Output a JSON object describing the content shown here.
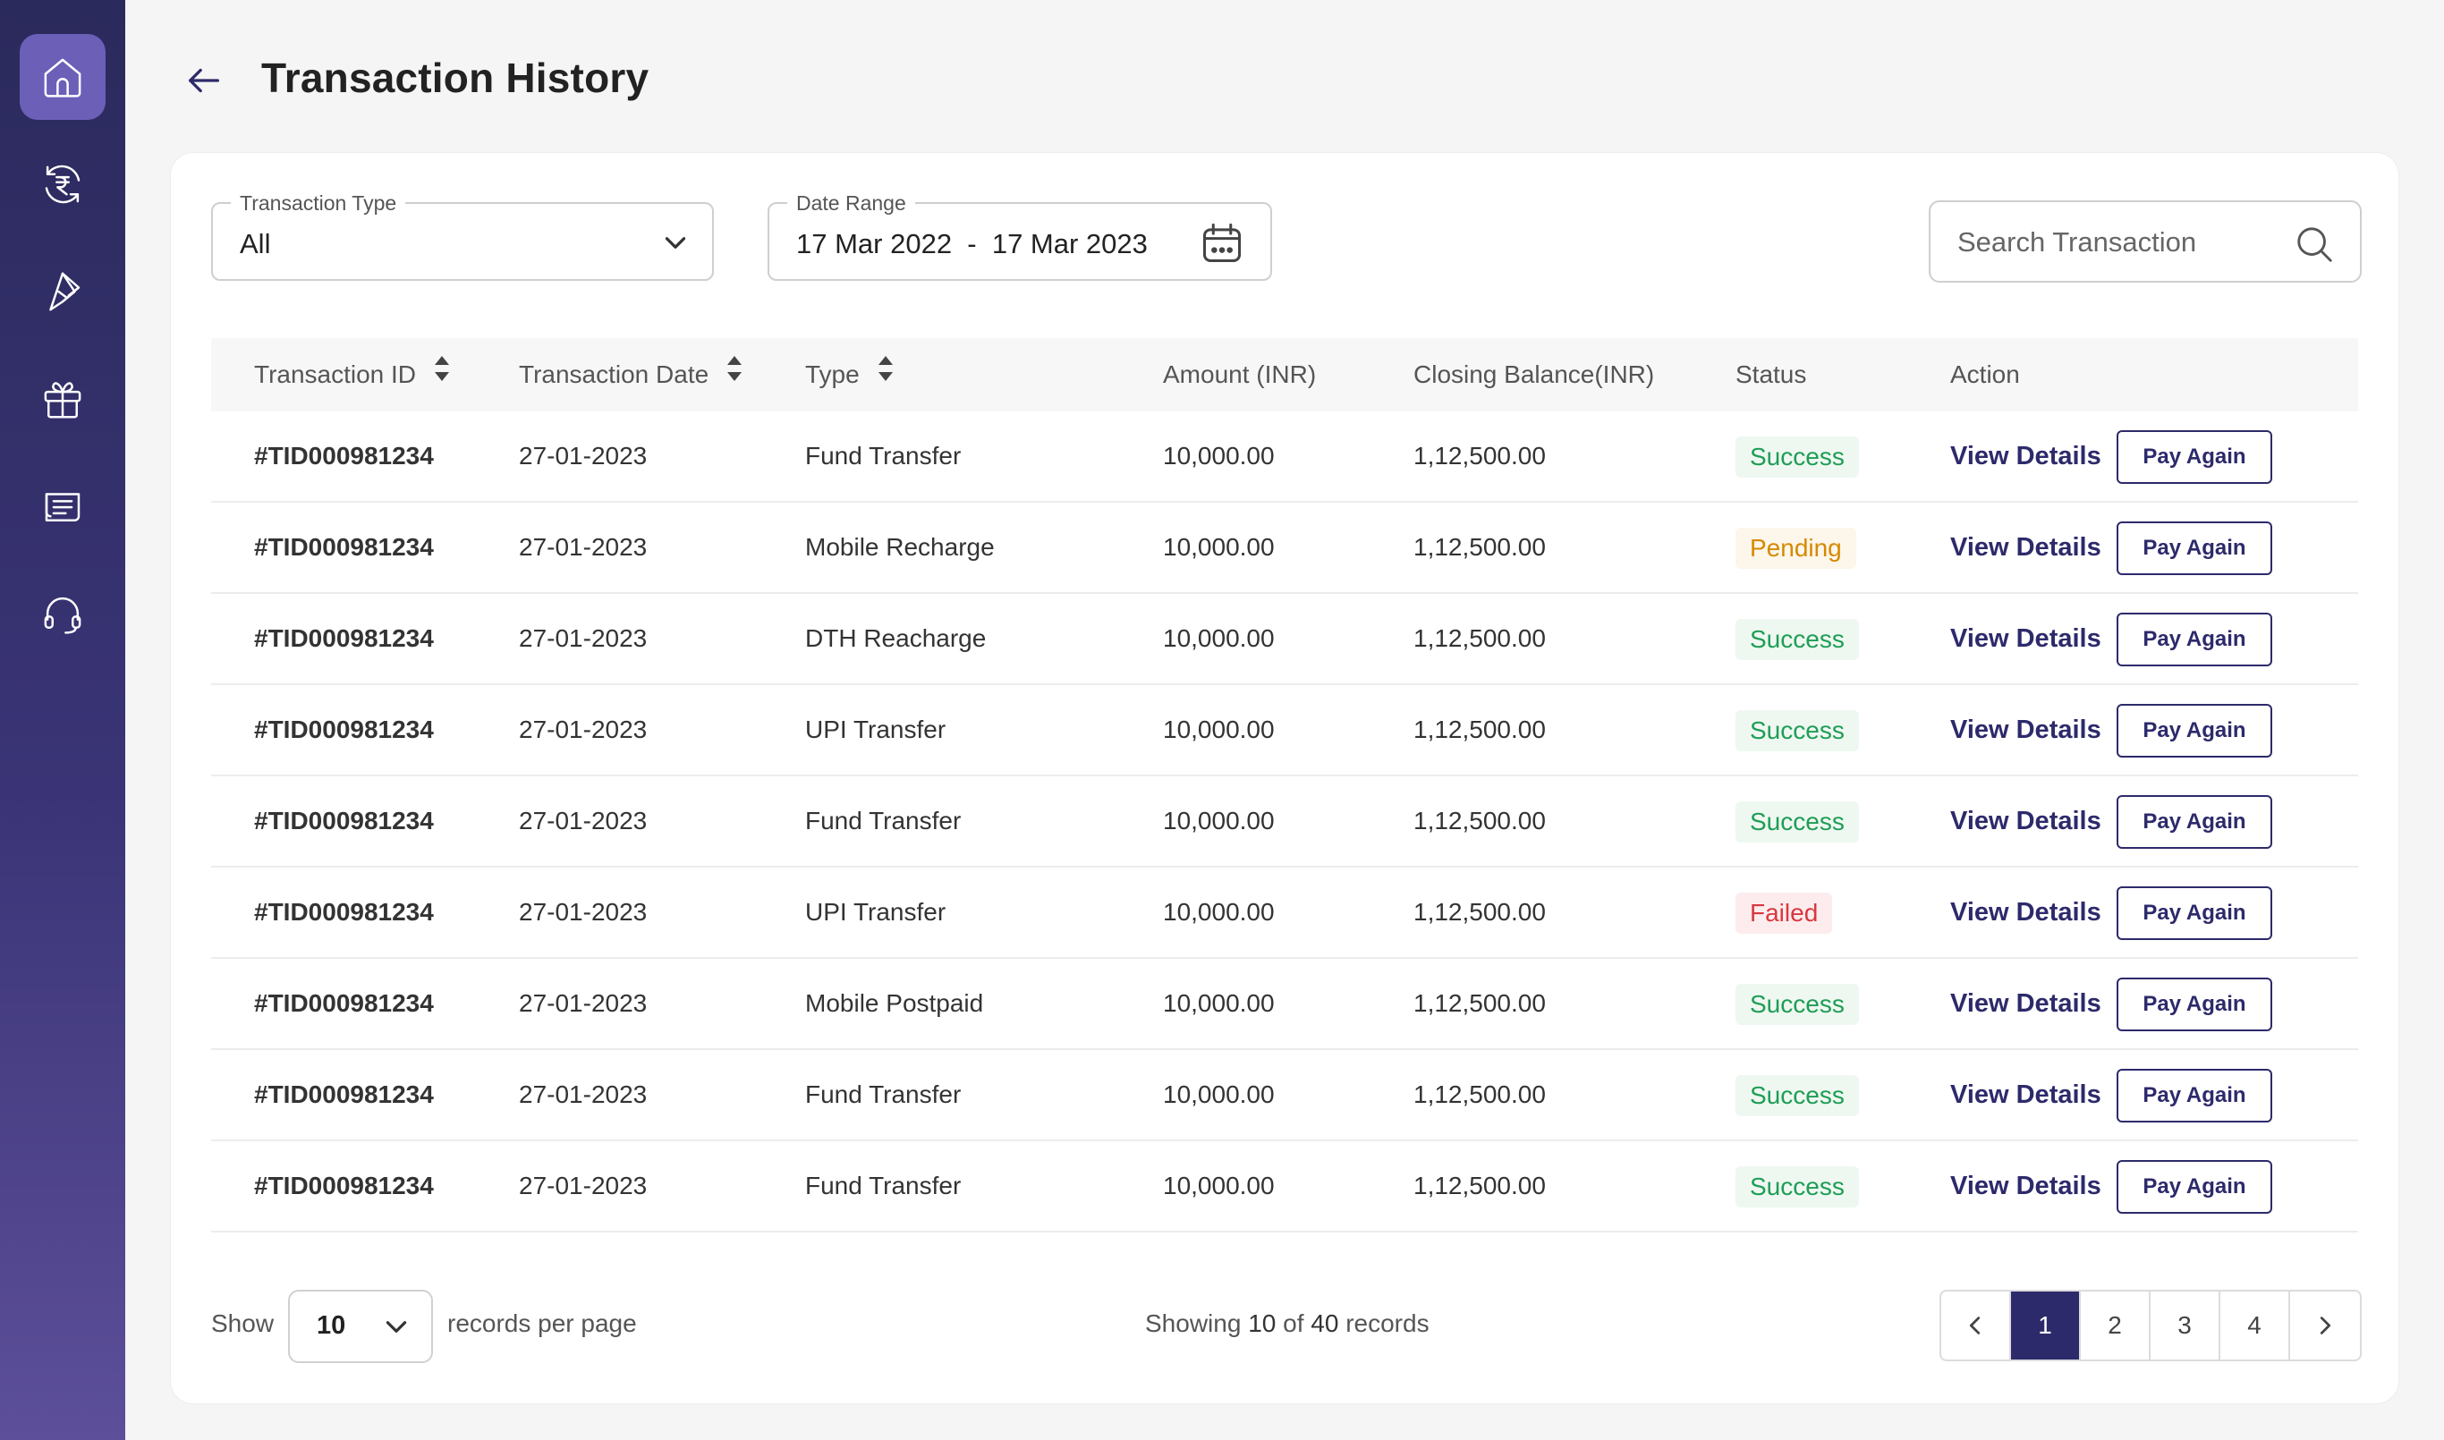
{
  "sidebar": {
    "items": [
      {
        "icon": "home-icon",
        "active": true
      },
      {
        "icon": "rupee-exchange-icon",
        "active": false
      },
      {
        "icon": "send-icon",
        "active": false
      },
      {
        "icon": "gift-icon",
        "active": false
      },
      {
        "icon": "bill-icon",
        "active": false
      },
      {
        "icon": "headset-icon",
        "active": false
      }
    ]
  },
  "header": {
    "title": "Transaction History"
  },
  "filters": {
    "transaction_type": {
      "label": "Transaction Type",
      "value": "All"
    },
    "date_range": {
      "label": "Date Range",
      "value": "17 Mar 2022  -  17 Mar 2023"
    },
    "search": {
      "placeholder": "Search Transaction"
    }
  },
  "table": {
    "headers": {
      "id": "Transaction ID",
      "date": "Transaction Date",
      "type": "Type",
      "amount": "Amount (INR)",
      "balance": "Closing Balance(INR)",
      "status": "Status",
      "action": "Action"
    },
    "view_label": "View Details",
    "pay_label": "Pay Again",
    "rows": [
      {
        "id": "#TID000981234",
        "date": "27-01-2023",
        "type": "Fund Transfer",
        "amount": "10,000.00",
        "balance": "1,12,500.00",
        "status": "Success",
        "status_kind": "success"
      },
      {
        "id": "#TID000981234",
        "date": "27-01-2023",
        "type": "Mobile Recharge",
        "amount": "10,000.00",
        "balance": "1,12,500.00",
        "status": "Pending",
        "status_kind": "pending"
      },
      {
        "id": "#TID000981234",
        "date": "27-01-2023",
        "type": "DTH Reacharge",
        "amount": "10,000.00",
        "balance": "1,12,500.00",
        "status": "Success",
        "status_kind": "success"
      },
      {
        "id": "#TID000981234",
        "date": "27-01-2023",
        "type": "UPI Transfer",
        "amount": "10,000.00",
        "balance": "1,12,500.00",
        "status": "Success",
        "status_kind": "success"
      },
      {
        "id": "#TID000981234",
        "date": "27-01-2023",
        "type": "Fund Transfer",
        "amount": "10,000.00",
        "balance": "1,12,500.00",
        "status": "Success",
        "status_kind": "success"
      },
      {
        "id": "#TID000981234",
        "date": "27-01-2023",
        "type": "UPI Transfer",
        "amount": "10,000.00",
        "balance": "1,12,500.00",
        "status": "Failed",
        "status_kind": "failed"
      },
      {
        "id": "#TID000981234",
        "date": "27-01-2023",
        "type": "Mobile Postpaid",
        "amount": "10,000.00",
        "balance": "1,12,500.00",
        "status": "Success",
        "status_kind": "success"
      },
      {
        "id": "#TID000981234",
        "date": "27-01-2023",
        "type": "Fund Transfer",
        "amount": "10,000.00",
        "balance": "1,12,500.00",
        "status": "Success",
        "status_kind": "success"
      },
      {
        "id": "#TID000981234",
        "date": "27-01-2023",
        "type": "Fund Transfer",
        "amount": "10,000.00",
        "balance": "1,12,500.00",
        "status": "Success",
        "status_kind": "success"
      }
    ]
  },
  "footer": {
    "show_label": "Show",
    "per_page": "10",
    "records_per_page_label": "records per page",
    "showing_prefix": "Showing",
    "showing_count": "10",
    "showing_of": "of",
    "showing_total": "40",
    "showing_suffix": "records",
    "pages": [
      "1",
      "2",
      "3",
      "4"
    ],
    "current_page": "1"
  },
  "colors": {
    "brand": "#2d2a6b",
    "success": "#1f9d55",
    "pending": "#d58a00",
    "failed": "#d9373f"
  }
}
